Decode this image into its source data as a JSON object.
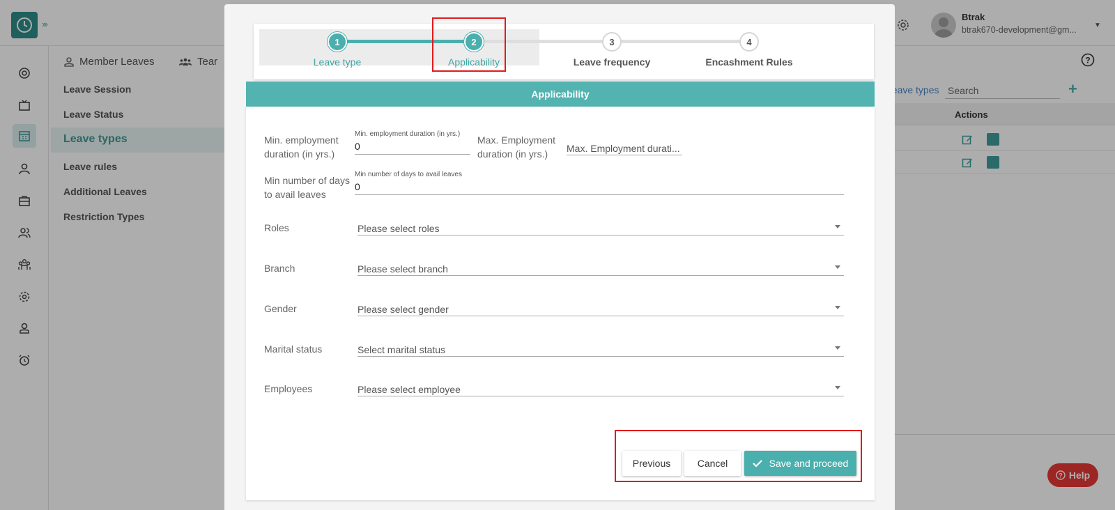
{
  "header": {
    "user_name": "Btrak",
    "user_email": "btrak670-development@gm..."
  },
  "subtabs": [
    {
      "label": "Member Leaves"
    },
    {
      "label": "Tear"
    }
  ],
  "leftmenu": {
    "items": [
      {
        "label": "Leave Session"
      },
      {
        "label": "Leave Status"
      },
      {
        "label": "Leave types"
      },
      {
        "label": "Leave rules"
      },
      {
        "label": "Additional Leaves"
      },
      {
        "label": "Restriction Types"
      }
    ]
  },
  "rightpanel": {
    "link": "ve leave types",
    "search_placeholder": "Search",
    "actions_header": "Actions"
  },
  "help_button": "Help",
  "dialog": {
    "steps": [
      {
        "num": "1",
        "label": "Leave type",
        "state": "done"
      },
      {
        "num": "2",
        "label": "Applicability",
        "state": "current"
      },
      {
        "num": "3",
        "label": "Leave frequency",
        "state": "todo"
      },
      {
        "num": "4",
        "label": "Encashment Rules",
        "state": "todo"
      }
    ],
    "section_title": "Applicability",
    "form": {
      "min_emp": {
        "label": "Min. employment duration (in yrs.)",
        "float_label": "Min. employment duration (in yrs.)",
        "value": "0"
      },
      "max_emp": {
        "label": "Max. Employment duration (in yrs.)",
        "placeholder": "Max. Employment durati..."
      },
      "min_days": {
        "label": "Min number of days to avail leaves",
        "float_label": "Min number of days to avail leaves",
        "value": "0"
      },
      "roles": {
        "label": "Roles",
        "placeholder": "Please select roles"
      },
      "branch": {
        "label": "Branch",
        "placeholder": "Please select branch"
      },
      "gender": {
        "label": "Gender",
        "placeholder": "Please select gender"
      },
      "marital": {
        "label": "Marital status",
        "placeholder": "Select marital status"
      },
      "employees": {
        "label": "Employees",
        "placeholder": "Please select employee"
      }
    },
    "buttons": {
      "previous": "Previous",
      "cancel": "Cancel",
      "save": "Save and proceed"
    }
  },
  "colors": {
    "accent": "#4aafad",
    "highlight_border": "#e21b1b",
    "help_bg": "#e53935"
  }
}
